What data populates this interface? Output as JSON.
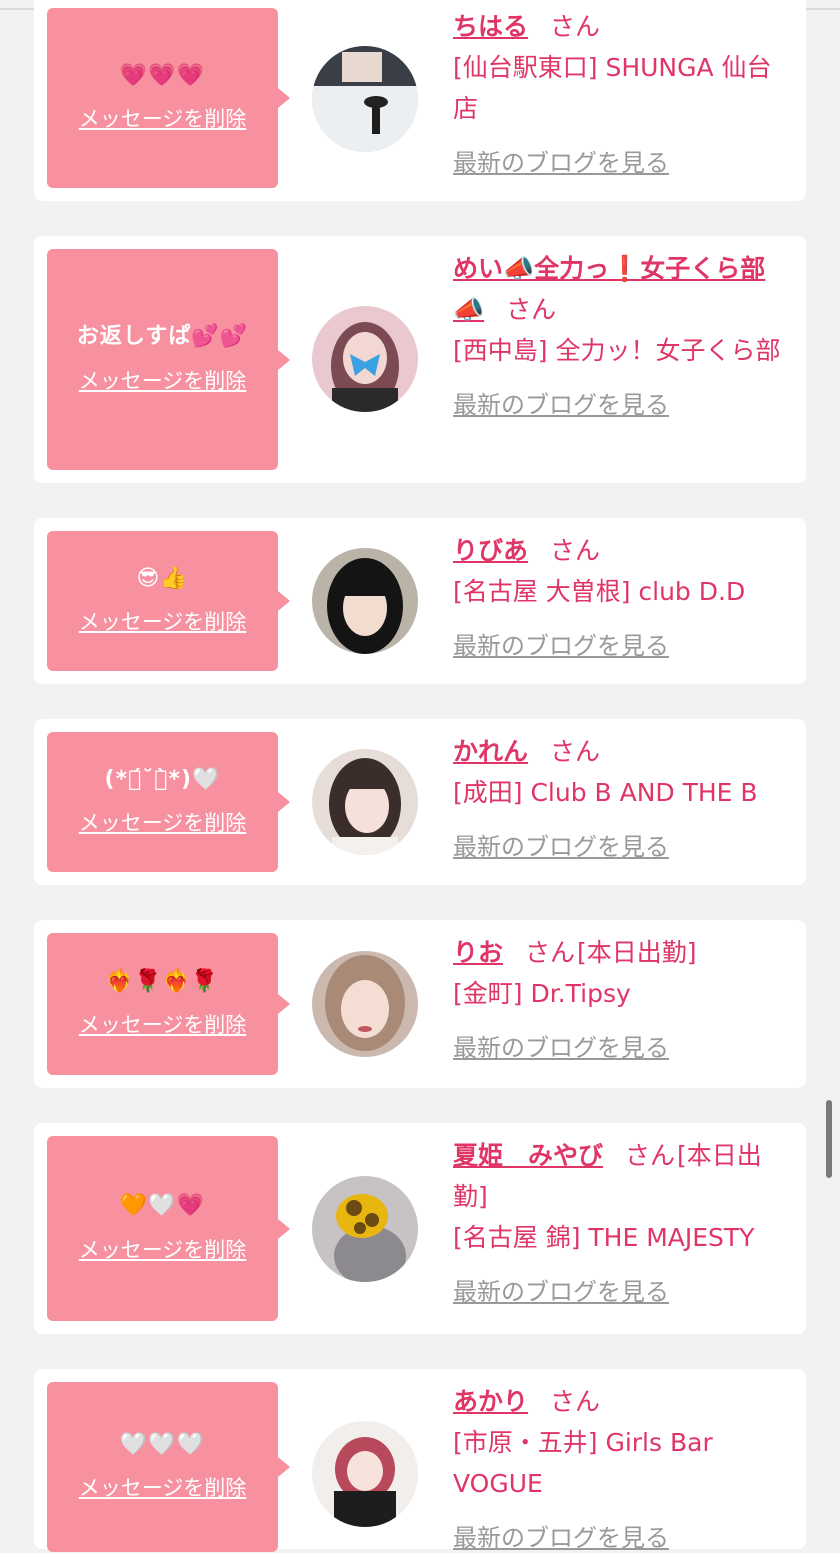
{
  "cards": [
    {
      "message": "💗💗💗",
      "delete_label": "メッセージを削除",
      "name": "ちはる",
      "san": "さん",
      "suffix": "",
      "shop": "[仙台駅東口] SHUNGA 仙台店",
      "blog_label": "最新のブログを見る"
    },
    {
      "message": "お返しすぱ💕💕",
      "delete_label": "メッセージを削除",
      "name": "めい📣全力っ❗女子くら部📣",
      "san": "さん",
      "suffix": "",
      "shop": "[西中島] 全力ッ！女子くら部",
      "blog_label": "最新のブログを見る"
    },
    {
      "message": "😎👍",
      "delete_label": "メッセージを削除",
      "name": "りびあ",
      "san": "さん",
      "suffix": "",
      "shop": "[名古屋 大曽根] club D.D",
      "blog_label": "最新のブログを見る"
    },
    {
      "message": "(*ฅ́˘ฅ̀*)🤍",
      "delete_label": "メッセージを削除",
      "name": "かれん",
      "san": "さん",
      "suffix": "",
      "shop": "[成田] Club B AND THE B",
      "blog_label": "最新のブログを見る"
    },
    {
      "message": "❤️‍🔥🌹❤️‍🔥🌹",
      "delete_label": "メッセージを削除",
      "name": "りお",
      "san": "さん",
      "suffix": "[本日出勤]",
      "shop": "[金町] Dr.Tipsy",
      "blog_label": "最新のブログを見る"
    },
    {
      "message": "🧡🤍💗",
      "delete_label": "メッセージを削除",
      "name": "夏姫　みやび",
      "san": "さん",
      "suffix": "[本日出勤]",
      "shop": "[名古屋 錦] THE MAJESTY",
      "blog_label": "最新のブログを見る"
    },
    {
      "message": "🤍🤍🤍",
      "delete_label": "メッセージを削除",
      "name": "あかり",
      "san": "さん",
      "suffix": "",
      "shop": "[市原・五井] Girls Bar VOGUE",
      "blog_label": "最新のブログを見る"
    }
  ],
  "colors": {
    "accent": "#e03567",
    "bubble": "#f7909f",
    "card": "#ffffff",
    "background": "#f2f2f2",
    "muted": "#999999"
  }
}
